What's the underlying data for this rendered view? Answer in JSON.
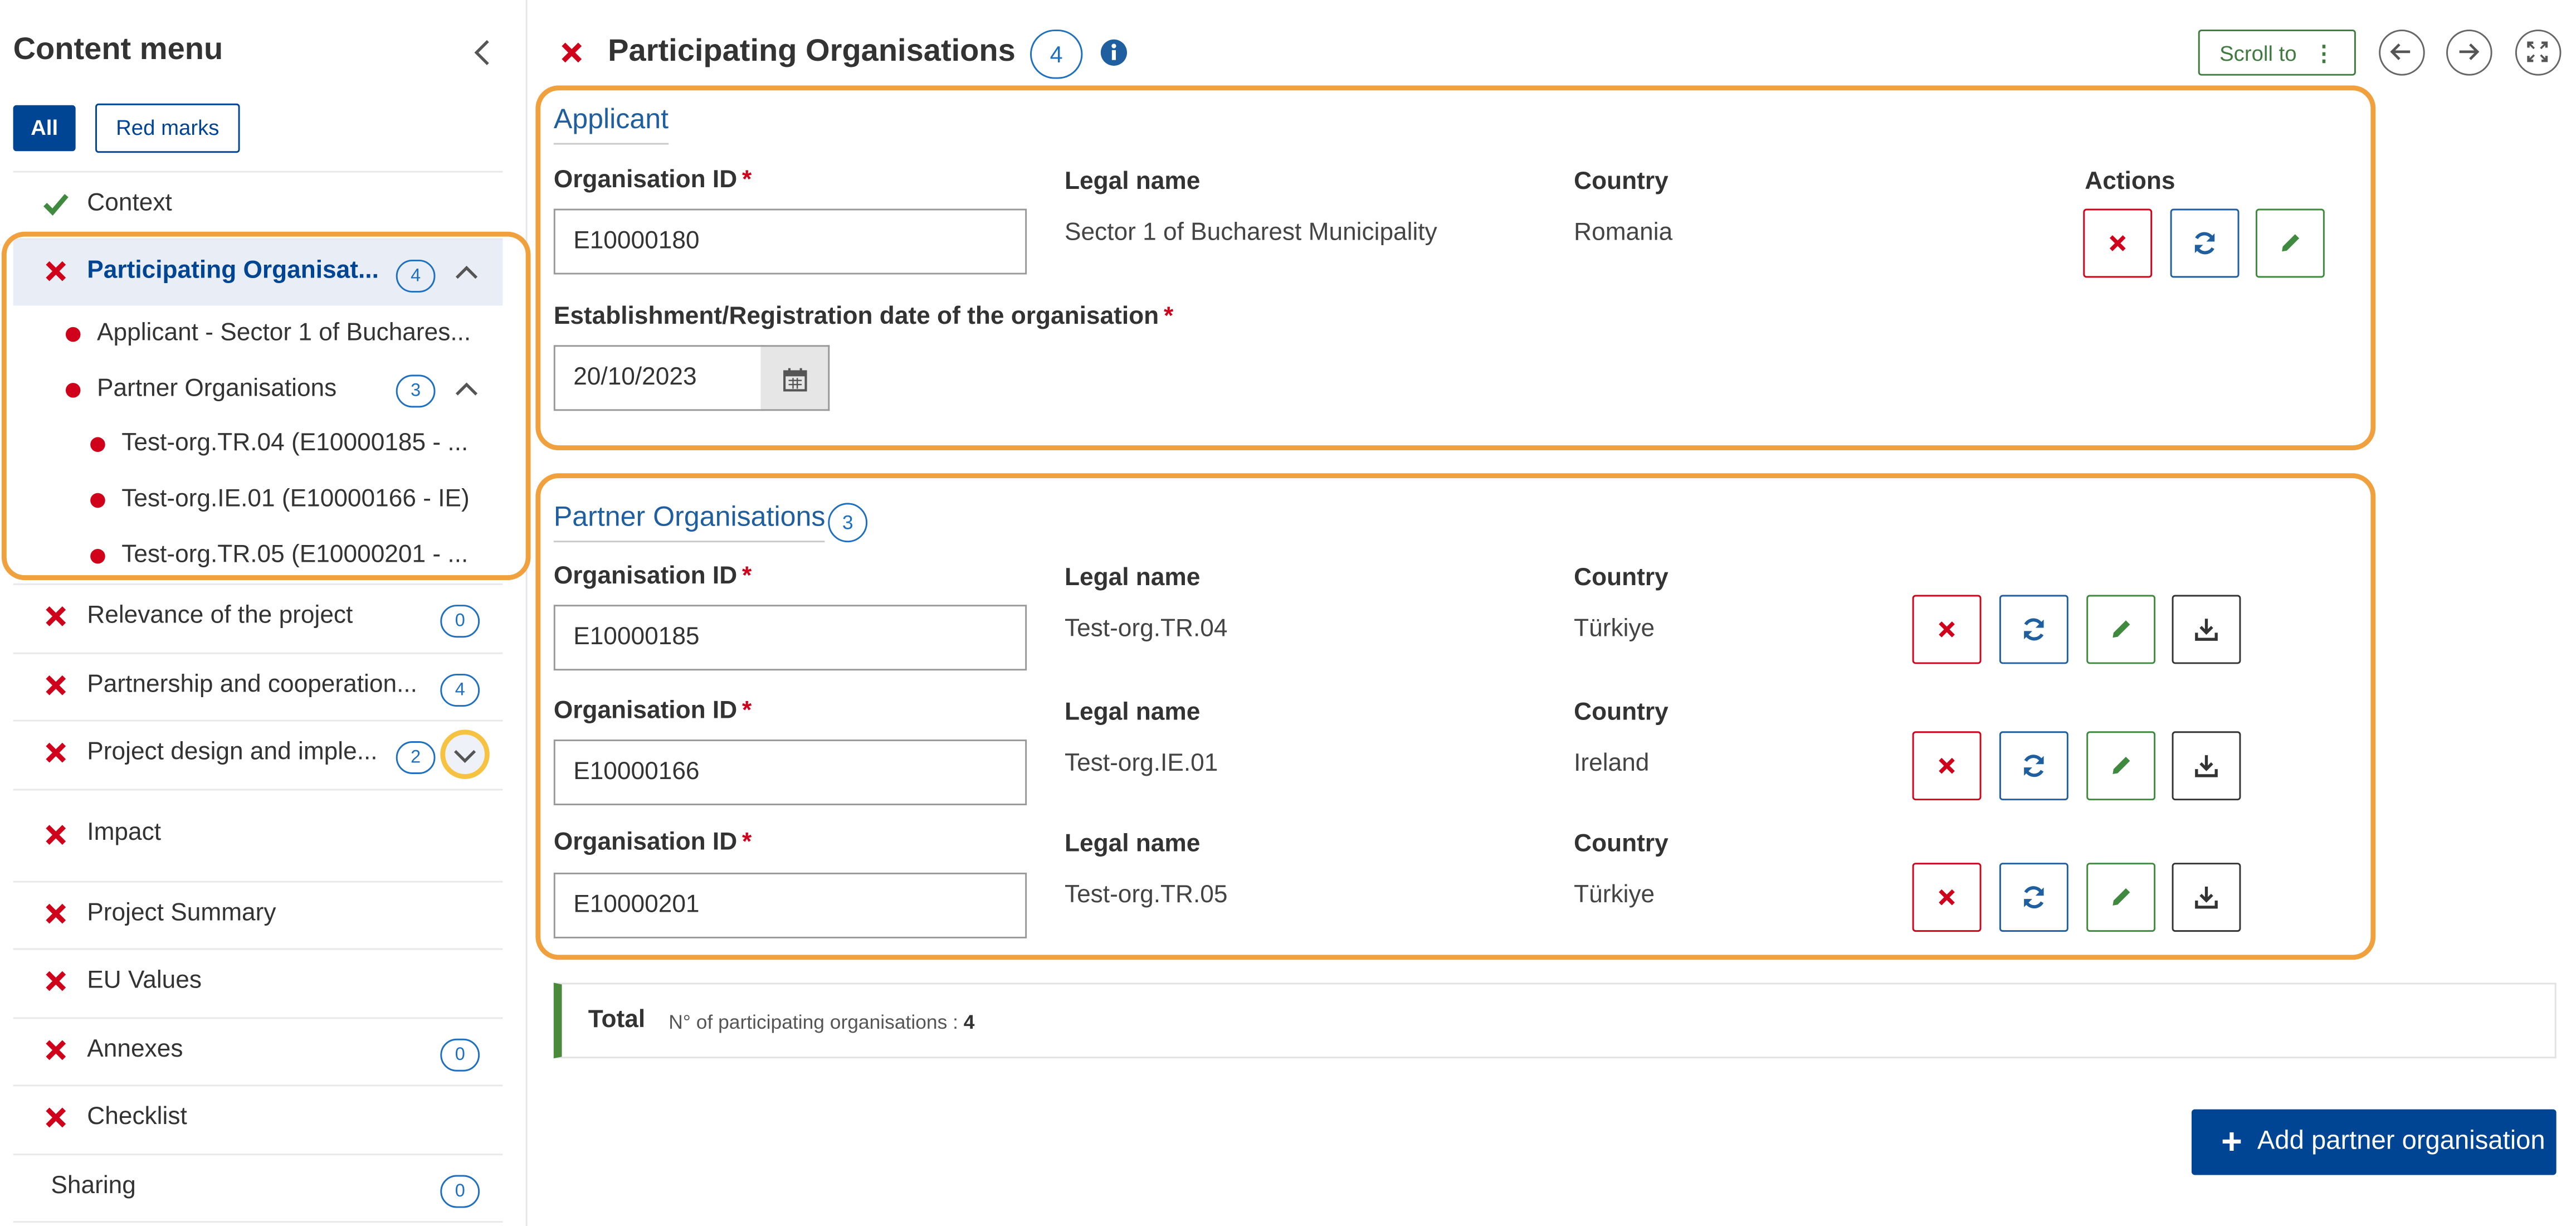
{
  "sidebar": {
    "title": "Content menu",
    "filter_all": "All",
    "filter_red": "Red marks",
    "items": [
      {
        "label": "Context",
        "status": "ok",
        "badge": ""
      },
      {
        "label": "Participating Organisat...",
        "status": "error",
        "badge": "4"
      },
      {
        "label": "Relevance of the project",
        "status": "error",
        "badge": "0"
      },
      {
        "label": "Partnership and cooperation...",
        "status": "error",
        "badge": "4"
      },
      {
        "label": "Project design and imple...",
        "status": "error",
        "badge": "2"
      },
      {
        "label": "Impact",
        "status": "error",
        "badge": ""
      },
      {
        "label": "Project Summary",
        "status": "error",
        "badge": ""
      },
      {
        "label": "EU Values",
        "status": "error",
        "badge": ""
      },
      {
        "label": "Annexes",
        "status": "error",
        "badge": "0"
      },
      {
        "label": "Checklist",
        "status": "error",
        "badge": ""
      },
      {
        "label": "Sharing",
        "status": "none",
        "badge": "0"
      }
    ],
    "sub_items": [
      {
        "label": "Applicant - Sector 1 of Buchares..."
      },
      {
        "label": "Partner Organisations",
        "badge": "3"
      },
      {
        "label": "Test-org.TR.04 (E10000185 - ..."
      },
      {
        "label": "Test-org.IE.01 (E10000166 - IE)"
      },
      {
        "label": "Test-org.TR.05 (E10000201 - ..."
      }
    ]
  },
  "header": {
    "title": "Participating Organisations",
    "count": "4",
    "scroll_to": "Scroll to",
    "scroll_dots": "⋮"
  },
  "applicant": {
    "title": "Applicant",
    "labels": {
      "org_id": "Organisation ID",
      "legal_name": "Legal name",
      "country": "Country",
      "actions": "Actions",
      "est_date": "Establishment/Registration date of the organisation",
      "required": "*"
    },
    "org_id": "E10000180",
    "legal_name": "Sector 1 of Bucharest Municipality",
    "country": "Romania",
    "date": "20/10/2023"
  },
  "partners": {
    "title": "Partner Organisations",
    "count": "3",
    "labels": {
      "org_id": "Organisation ID",
      "legal_name": "Legal name",
      "country": "Country",
      "required": "*"
    },
    "rows": [
      {
        "org_id": "E10000185",
        "legal_name": "Test-org.TR.04",
        "country": "Türkiye"
      },
      {
        "org_id": "E10000166",
        "legal_name": "Test-org.IE.01",
        "country": "Ireland"
      },
      {
        "org_id": "E10000201",
        "legal_name": "Test-org.TR.05",
        "country": "Türkiye"
      }
    ]
  },
  "total": {
    "title": "Total",
    "text": "N° of participating organisations : ",
    "value": "4"
  },
  "add_button": {
    "label": "Add partner organisation",
    "plus": "+"
  },
  "colors": {
    "primary": "#004494",
    "error": "#d0021b",
    "success": "#3f8a3f",
    "highlight": "#f0a03c"
  }
}
